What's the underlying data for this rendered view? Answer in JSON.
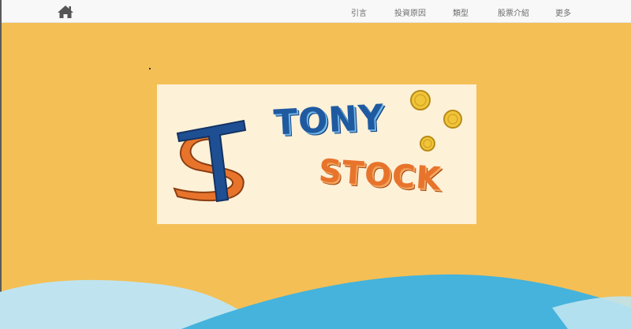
{
  "navbar": {
    "home_icon": "home-icon",
    "items": [
      {
        "label": "引言"
      },
      {
        "label": "投資原因"
      },
      {
        "label": "類型"
      },
      {
        "label": "股票介紹"
      },
      {
        "label": "更多"
      }
    ]
  },
  "hero": {
    "logo": {
      "monogram": "TS",
      "word1": "TONY",
      "word2": "STOCK",
      "coin_symbol": "$"
    }
  },
  "colors": {
    "background": "#f4bf55",
    "navbar": "#f8f8f8",
    "logo_card": "#fdf1d8",
    "logo_blue": "#1f5aa0",
    "logo_orange": "#e8742c",
    "wave_light": "#bfe4ef",
    "wave_blue": "#45b3dc"
  }
}
